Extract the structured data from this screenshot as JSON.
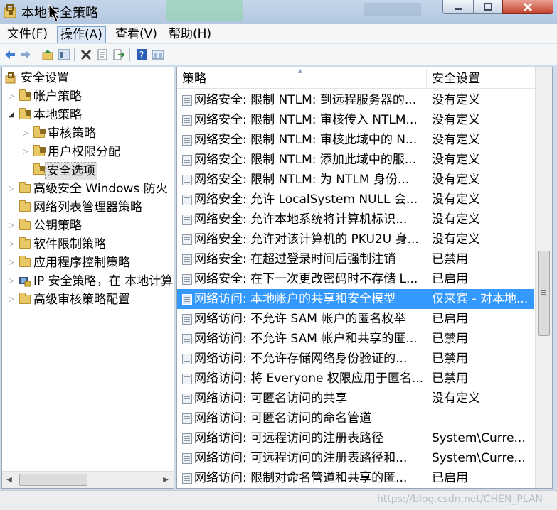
{
  "window": {
    "title": "本地安全策略"
  },
  "menu": [
    {
      "label": "文件(F)"
    },
    {
      "label": "操作(A)"
    },
    {
      "label": "查看(V)"
    },
    {
      "label": "帮助(H)"
    }
  ],
  "tree": {
    "root": "安全设置",
    "items": [
      {
        "label": "帐户策略"
      },
      {
        "label": "本地策略"
      },
      {
        "label": "审核策略"
      },
      {
        "label": "用户权限分配"
      },
      {
        "label": "安全选项"
      },
      {
        "label": "高级安全 Windows 防火"
      },
      {
        "label": "网络列表管理器策略"
      },
      {
        "label": "公钥策略"
      },
      {
        "label": "软件限制策略"
      },
      {
        "label": "应用程序控制策略"
      },
      {
        "label": "IP 安全策略，在 本地计算"
      },
      {
        "label": "高级审核策略配置"
      }
    ]
  },
  "list": {
    "columns": {
      "policy": "策略",
      "setting": "安全设置"
    },
    "rows": [
      {
        "policy": "网络安全: 限制 NTLM: 到远程服务器的...",
        "setting": "没有定义"
      },
      {
        "policy": "网络安全: 限制 NTLM: 审核传入 NTLM...",
        "setting": "没有定义"
      },
      {
        "policy": "网络安全: 限制 NTLM: 审核此域中的 N...",
        "setting": "没有定义"
      },
      {
        "policy": "网络安全: 限制 NTLM: 添加此域中的服...",
        "setting": "没有定义"
      },
      {
        "policy": "网络安全: 限制 NTLM: 为 NTLM 身份...",
        "setting": "没有定义"
      },
      {
        "policy": "网络安全: 允许 LocalSystem NULL 会...",
        "setting": "没有定义"
      },
      {
        "policy": "网络安全: 允许本地系统将计算机标识...",
        "setting": "没有定义"
      },
      {
        "policy": "网络安全: 允许对该计算机的 PKU2U 身...",
        "setting": "没有定义"
      },
      {
        "policy": "网络安全: 在超过登录时间后强制注销",
        "setting": "已禁用"
      },
      {
        "policy": "网络安全: 在下一次更改密码时不存储 L...",
        "setting": "已启用"
      },
      {
        "policy": "网络访问: 本地帐户的共享和安全模型",
        "setting": "仅来宾 - 对本地..."
      },
      {
        "policy": "网络访问: 不允许 SAM 帐户的匿名枚举",
        "setting": "已启用"
      },
      {
        "policy": "网络访问: 不允许 SAM 帐户和共享的匿...",
        "setting": "已禁用"
      },
      {
        "policy": "网络访问: 不允许存储网络身份验证的...",
        "setting": "已禁用"
      },
      {
        "policy": "网络访问: 将 Everyone 权限应用于匿名...",
        "setting": "已禁用"
      },
      {
        "policy": "网络访问: 可匿名访问的共享",
        "setting": "没有定义"
      },
      {
        "policy": "网络访问: 可匿名访问的命名管道",
        "setting": ""
      },
      {
        "policy": "网络访问: 可远程访问的注册表路径",
        "setting": "System\\Curre..."
      },
      {
        "policy": "网络访问: 可远程访问的注册表路径和...",
        "setting": "System\\Curre..."
      },
      {
        "policy": "网络访问: 限制对命名管道和共享的匿...",
        "setting": "已启用"
      }
    ]
  },
  "status": {
    "watermark": "https://blog.csdn.net/CHEN_PLAN"
  }
}
